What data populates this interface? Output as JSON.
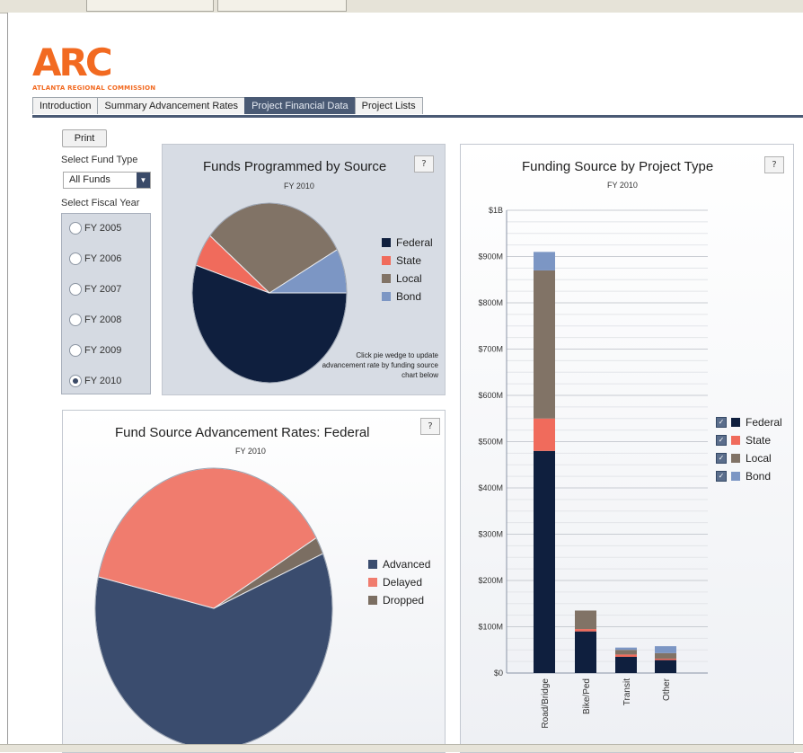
{
  "app": {
    "logo_text": "ARC",
    "org_name": "ATLANTA REGIONAL COMMISSION"
  },
  "tabs": [
    {
      "label": "Introduction",
      "active": false
    },
    {
      "label": "Summary Advancement Rates",
      "active": false
    },
    {
      "label": "Project Financial Data",
      "active": true
    },
    {
      "label": "Project Lists",
      "active": false
    }
  ],
  "controls": {
    "print_label": "Print",
    "fund_type_label": "Select Fund Type",
    "fund_type_value": "All Funds",
    "fiscal_year_label": "Select Fiscal Year",
    "fiscal_years": [
      {
        "label": "FY 2005",
        "selected": false
      },
      {
        "label": "FY 2006",
        "selected": false
      },
      {
        "label": "FY 2007",
        "selected": false
      },
      {
        "label": "FY 2008",
        "selected": false
      },
      {
        "label": "FY 2009",
        "selected": false
      },
      {
        "label": "FY 2010",
        "selected": true
      }
    ]
  },
  "help_label": "?",
  "colors": {
    "Federal": "#0f1f3e",
    "State": "#f06b5c",
    "Local": "#817366",
    "Bond": "#7c96c4",
    "Advanced": "#3a4c6e",
    "Delayed": "#f07c6e",
    "Dropped": "#7b6e62",
    "accent": "#4a5a74",
    "brand": "#f26a21"
  },
  "chart_data": [
    {
      "type": "pie",
      "title": "Funds Programmed by Source",
      "subtitle": "FY 2010",
      "labels": [
        "Federal",
        "State",
        "Local",
        "Bond"
      ],
      "values": [
        55,
        6,
        31,
        8
      ],
      "legend_position": "right",
      "note": "Click pie wedge to update advancement rate by funding source chart below"
    },
    {
      "type": "pie",
      "title": "Fund Source Advancement Rates: Federal",
      "subtitle": "FY 2010",
      "labels": [
        "Advanced",
        "Delayed",
        "Dropped"
      ],
      "values": [
        60,
        38,
        2
      ],
      "legend_position": "right"
    },
    {
      "type": "bar",
      "stacked": true,
      "title": "Funding Source by Project Type",
      "subtitle": "FY 2010",
      "categories": [
        "Road/Bridge",
        "Bike/Ped",
        "Transit",
        "Other"
      ],
      "series": [
        {
          "name": "Federal",
          "values": [
            480,
            90,
            35,
            28
          ]
        },
        {
          "name": "State",
          "values": [
            70,
            5,
            5,
            3
          ]
        },
        {
          "name": "Local",
          "values": [
            320,
            40,
            10,
            12
          ]
        },
        {
          "name": "Bond",
          "values": [
            40,
            0,
            5,
            15
          ]
        }
      ],
      "ylim": [
        0,
        1000
      ],
      "yticks": [
        "$0",
        "$100M",
        "$200M",
        "$300M",
        "$400M",
        "$500M",
        "$600M",
        "$700M",
        "$800M",
        "$900M",
        "$1B"
      ],
      "grid": true,
      "legend_position": "right"
    }
  ]
}
